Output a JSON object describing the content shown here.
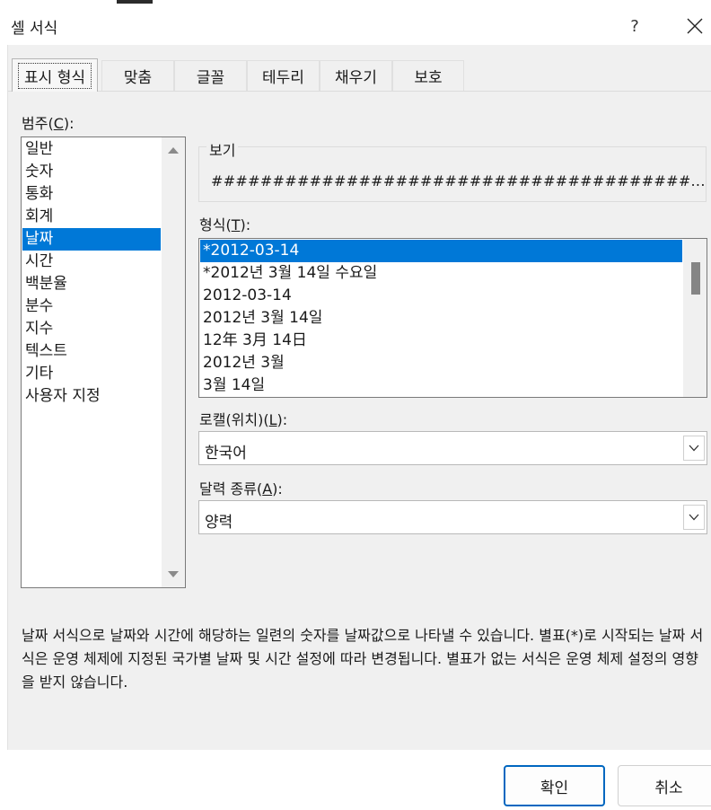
{
  "window": {
    "title": "셀 서식",
    "help": "?"
  },
  "tabs": [
    {
      "label": "표시 형식",
      "active": true
    },
    {
      "label": "맞춤"
    },
    {
      "label": "글꼴"
    },
    {
      "label": "테두리"
    },
    {
      "label": "채우기"
    },
    {
      "label": "보호"
    }
  ],
  "category": {
    "label_pre": "범주(",
    "label_key": "C",
    "label_post": "):",
    "items": [
      "일반",
      "숫자",
      "통화",
      "회계",
      "날짜",
      "시간",
      "백분율",
      "분수",
      "지수",
      "텍스트",
      "기타",
      "사용자 지정"
    ],
    "selected": "날짜"
  },
  "preview": {
    "label": "보기",
    "value": "#######################################..."
  },
  "format": {
    "label_pre": "형식(",
    "label_key": "T",
    "label_post": "):",
    "items": [
      "*2012-03-14",
      "*2012년 3월 14일 수요일",
      "2012-03-14",
      "2012년 3월 14일",
      "12年 3月 14日",
      "2012년 3월",
      "3월 14일"
    ],
    "selected": "*2012-03-14"
  },
  "locale": {
    "label_pre": "로캘(위치)(",
    "label_key": "L",
    "label_post": "):",
    "value": "한국어"
  },
  "calendar": {
    "label_pre": "달력 종류(",
    "label_key": "A",
    "label_post": "):",
    "value": "양력"
  },
  "description": "날짜 서식으로 날짜와 시간에 해당하는 일련의 숫자를 날짜값으로 나타낼 수 있습니다. 별표(*)로 시작되는 날짜 서식은 운영 체제에 지정된 국가별 날짜 및 시간 설정에 따라 변경됩니다. 별표가 없는 서식은 운영 체제 설정의 영향을 받지 않습니다.",
  "buttons": {
    "ok": "확인",
    "cancel": "취소"
  },
  "colors": {
    "selection": "#0078d7",
    "dialog_bg": "#f0f0f0",
    "primary_border": "#0067c0"
  }
}
